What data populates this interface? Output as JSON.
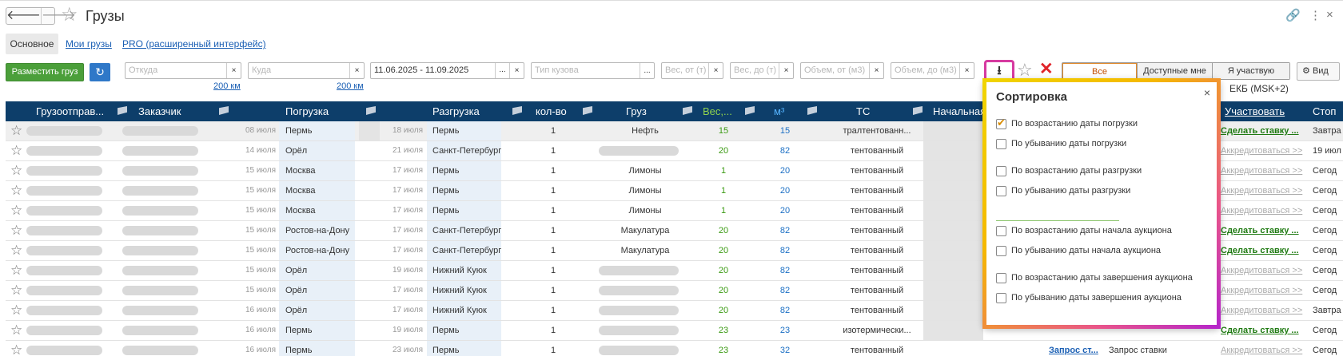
{
  "header": {
    "back": "🡐",
    "forward": "🡒",
    "title": "Грузы",
    "link_icon": "🔗",
    "more_icon": "⋮",
    "close_icon": "×"
  },
  "tabs": [
    {
      "label": "Основное",
      "active": true
    },
    {
      "label": "Мои грузы"
    },
    {
      "label": "PRO (расширенный интерфейс)"
    }
  ],
  "toolbar": {
    "place_cargo": "Разместить груз",
    "refresh_icon": "↻",
    "from_placeholder": "Откуда",
    "to_placeholder": "Куда",
    "from_radius": "200 км",
    "to_radius": "200 км",
    "date_range": "11.06.2025 - 11.09.2025",
    "body_type_placeholder": "Тип кузова",
    "weight_from_placeholder": "Вес, от (т)",
    "weight_to_placeholder": "Вес, до (т)",
    "volume_from_placeholder": "Объем, от (м3)",
    "volume_to_placeholder": "Объем, до (м3)",
    "sort_icon": "⭳",
    "clear_icon": "✕",
    "filter_all": "Все",
    "filter_available": "Доступные мне",
    "filter_participate": "Я участвую",
    "view_label": "Вид",
    "timezone": "ЕКБ (MSK+2)"
  },
  "table": {
    "columns": [
      "Грузоотправ...",
      "Заказчик",
      "Погрузка",
      "Разгрузка",
      "кол-во",
      "Груз",
      "Вес,...",
      "м³",
      "ТС",
      "Начальная",
      "Участвовать",
      "Стоп"
    ],
    "rows": [
      {
        "load_date": "08 июля",
        "load_city": "Пермь",
        "unload_date": "18 июля",
        "unload_city": "Пермь",
        "qty": "1",
        "cargo": "Нефть",
        "weight": "15",
        "volume": "15",
        "ts": "тралтентованн...",
        "action": "Сделать ставку ...",
        "action_type": "bold",
        "stop": "Завтра"
      },
      {
        "load_date": "14 июля",
        "load_city": "Орёл",
        "unload_date": "21 июля",
        "unload_city": "Санкт-Петербург",
        "qty": "1",
        "cargo": "",
        "weight": "20",
        "volume": "82",
        "ts": "тентованный",
        "action": "Аккредитоваться >>",
        "action_type": "gray",
        "stop": "19 июл"
      },
      {
        "load_date": "15 июля",
        "load_city": "Москва",
        "unload_date": "17 июля",
        "unload_city": "Пермь",
        "qty": "1",
        "cargo": "Лимоны",
        "weight": "1",
        "volume": "20",
        "ts": "тентованный",
        "action": "Аккредитоваться >>",
        "action_type": "gray",
        "stop": "Сегод"
      },
      {
        "load_date": "15 июля",
        "load_city": "Москва",
        "unload_date": "17 июля",
        "unload_city": "Пермь",
        "qty": "1",
        "cargo": "Лимоны",
        "weight": "1",
        "volume": "20",
        "ts": "тентованный",
        "action": "Аккредитоваться >>",
        "action_type": "gray",
        "stop": "Сегод"
      },
      {
        "load_date": "15 июля",
        "load_city": "Москва",
        "unload_date": "17 июля",
        "unload_city": "Пермь",
        "qty": "1",
        "cargo": "Лимоны",
        "weight": "1",
        "volume": "20",
        "ts": "тентованный",
        "action": "Аккредитоваться >>",
        "action_type": "gray",
        "stop": "Сегод"
      },
      {
        "load_date": "15 июля",
        "load_city": "Ростов-на-Дону",
        "unload_date": "17 июля",
        "unload_city": "Санкт-Петербург",
        "qty": "1",
        "cargo": "Макулатура",
        "weight": "20",
        "volume": "82",
        "ts": "тентованный",
        "action": "Сделать ставку ...",
        "action_type": "bold",
        "stop": "Сегод"
      },
      {
        "load_date": "15 июля",
        "load_city": "Ростов-на-Дону",
        "unload_date": "17 июля",
        "unload_city": "Санкт-Петербург",
        "qty": "1",
        "cargo": "Макулатура",
        "weight": "20",
        "volume": "82",
        "ts": "тентованный",
        "action": "Сделать ставку ...",
        "action_type": "bold",
        "stop": "Сегод"
      },
      {
        "load_date": "15 июля",
        "load_city": "Орёл",
        "unload_date": "19 июля",
        "unload_city": "Нижний Куюк",
        "qty": "1",
        "cargo": "",
        "weight": "20",
        "volume": "82",
        "ts": "тентованный",
        "action": "Аккредитоваться >>",
        "action_type": "gray",
        "stop": "Сегод"
      },
      {
        "load_date": "15 июля",
        "load_city": "Орёл",
        "unload_date": "17 июля",
        "unload_city": "Нижний Куюк",
        "qty": "1",
        "cargo": "",
        "weight": "20",
        "volume": "82",
        "ts": "тентованный",
        "action": "Аккредитоваться >>",
        "action_type": "gray",
        "stop": "Сегод"
      },
      {
        "load_date": "16 июля",
        "load_city": "Орёл",
        "unload_date": "17 июля",
        "unload_city": "Нижний Куюк",
        "qty": "1",
        "cargo": "",
        "weight": "20",
        "volume": "82",
        "ts": "тентованный",
        "action": "Аккредитоваться >>",
        "action_type": "gray",
        "stop": "Завтра"
      },
      {
        "load_date": "16 июля",
        "load_city": "Пермь",
        "unload_date": "19 июля",
        "unload_city": "Пермь",
        "qty": "1",
        "cargo": "",
        "weight": "23",
        "volume": "23",
        "ts": "изотермически...",
        "action": "Сделать ставку ...",
        "action_type": "bold",
        "stop": "Сегод"
      },
      {
        "load_date": "16 июля",
        "load_city": "Пермь",
        "unload_date": "23 июля",
        "unload_city": "Пермь",
        "qty": "1",
        "cargo": "",
        "weight": "23",
        "volume": "32",
        "ts": "тентованный",
        "action": "Аккредитоваться >>",
        "action_type": "gray",
        "stop": "Сегод"
      }
    ],
    "last_row_extra": {
      "link": "Запрос ст...",
      "text": "Запрос ставки"
    }
  },
  "sort_popup": {
    "title": "Сортировка",
    "close": "×",
    "options": [
      {
        "label": "По возрастанию даты погрузки",
        "checked": true
      },
      {
        "label": "По убыванию даты погрузки",
        "checked": false
      },
      {
        "label": "По возрастанию даты разгрузки",
        "checked": false
      },
      {
        "label": "По убыванию даты разгрузки",
        "checked": false
      },
      {
        "label": "По возрастанию даты начала аукциона",
        "checked": false
      },
      {
        "label": "По убыванию даты начала аукциона",
        "checked": false
      },
      {
        "label": "По возрастанию даты завершения аукциона",
        "checked": false
      },
      {
        "label": "По убыванию даты завершения аукциона",
        "checked": false
      }
    ]
  },
  "colors": {
    "header_bg": "#0d3e6a",
    "accent_green": "#4b9f3a",
    "link_blue": "#1a5fb4",
    "highlight_pink": "#d63aa0"
  }
}
